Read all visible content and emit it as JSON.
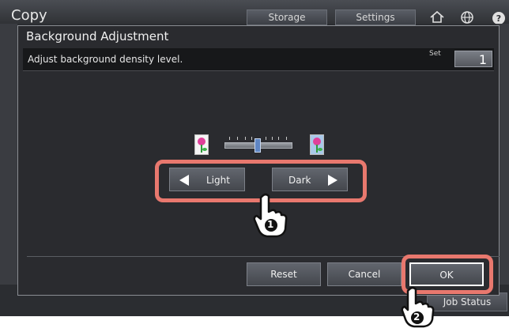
{
  "app": {
    "title": "Copy",
    "tabs": [
      "Storage",
      "Settings"
    ],
    "job_status_label": "Job Status"
  },
  "dialog": {
    "title": "Background Adjustment",
    "instruction": "Adjust background density level.",
    "set_label": "Set",
    "set_value": "1",
    "light_label": "Light",
    "dark_label": "Dark",
    "slider_level_fraction": 0.5,
    "reset_label": "Reset",
    "cancel_label": "Cancel",
    "ok_label": "OK"
  },
  "annotations": {
    "step1": "1",
    "step2": "2",
    "highlight_color": "#e8786e"
  },
  "icons": [
    "home-icon",
    "globe-icon",
    "help-icon",
    "light-flower-icon",
    "dark-flower-icon",
    "left-arrow-icon",
    "right-arrow-icon",
    "pointer-hand-icon"
  ]
}
